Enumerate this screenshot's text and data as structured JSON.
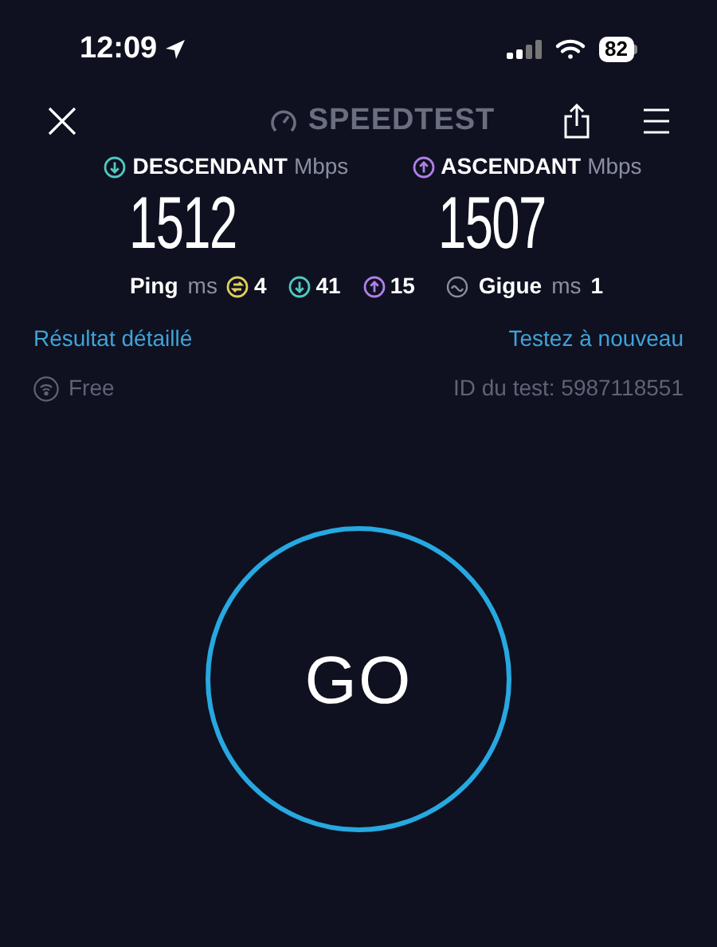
{
  "status_bar": {
    "time": "12:09",
    "battery": "82"
  },
  "header": {
    "logo": "SPEEDTEST"
  },
  "results": [
    {
      "kind": "download",
      "label": "DESCENDANT",
      "unit": "Mbps",
      "value": "1512",
      "color": "#4fc9c0"
    },
    {
      "kind": "upload",
      "label": "ASCENDANT",
      "unit": "Mbps",
      "value": "1507",
      "color": "#b07fe8"
    }
  ],
  "ping": {
    "label": "Ping",
    "unit": "ms",
    "values": [
      {
        "kind": "idle",
        "value": "4",
        "color": "#e0cf5a"
      },
      {
        "kind": "download",
        "value": "41",
        "color": "#4fc9c0"
      },
      {
        "kind": "upload",
        "value": "15",
        "color": "#b07fe8"
      }
    ]
  },
  "jitter": {
    "label": "Gigue",
    "unit": "ms",
    "value": "1"
  },
  "links": {
    "detail": "Résultat détaillé",
    "retest": "Testez à nouveau"
  },
  "network": {
    "name": "Free",
    "test_id": "ID du test: 5987118551"
  },
  "go_button": {
    "label": "GO"
  }
}
